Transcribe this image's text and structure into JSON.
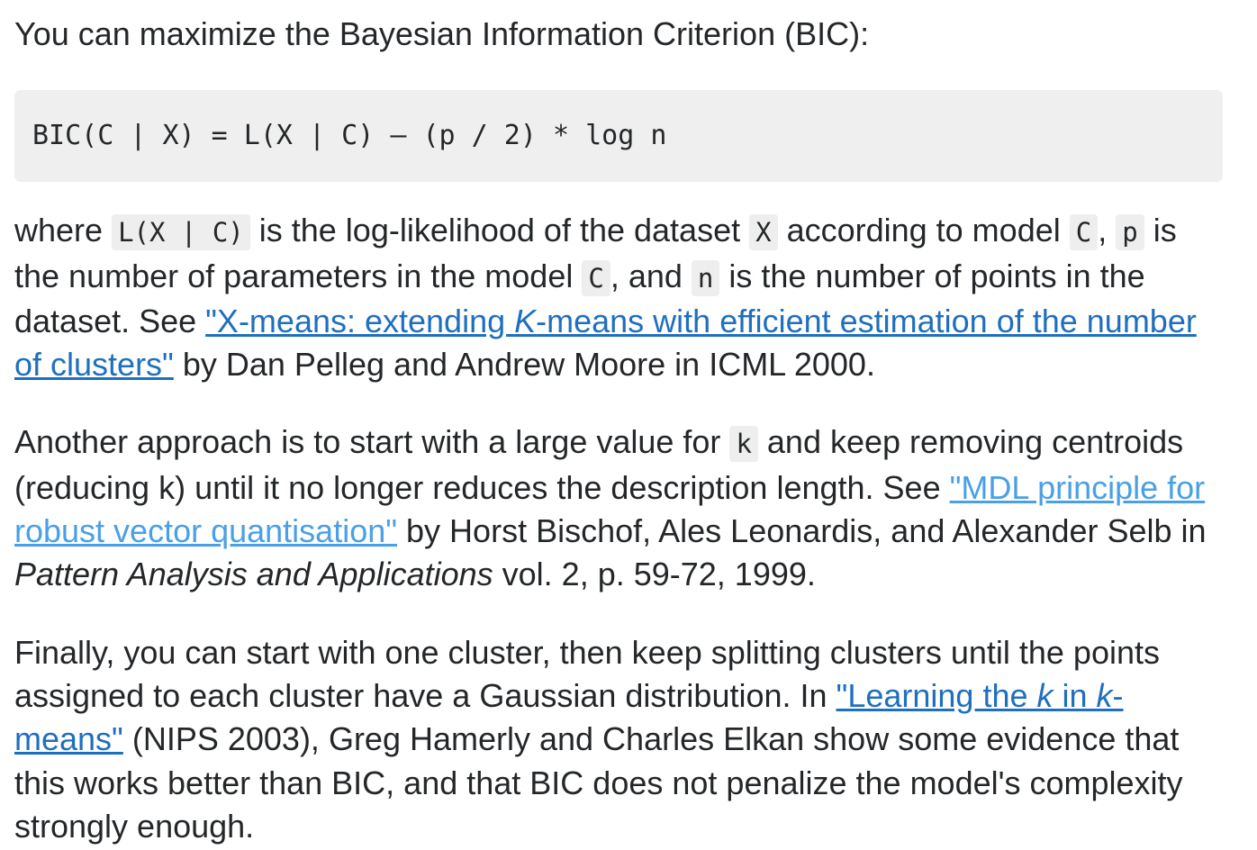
{
  "intro": {
    "text": "You can maximize the Bayesian Information Criterion (BIC):"
  },
  "formula": {
    "code": "BIC(C | X) = L(X | C) – (p / 2) * log n"
  },
  "where_paragraph": {
    "t1": "where ",
    "c1": "L(X | C)",
    "t2": " is the log-likelihood of the dataset ",
    "c2": "X",
    "t3": " according to model ",
    "c3": "C",
    "t4": ", ",
    "c4": "p",
    "t5": " is the number of parameters in the model ",
    "c5": "C",
    "t6": ", and ",
    "c6": "n",
    "t7": " is the number of points in the dataset. See ",
    "link_a": "\"X-means: extending ",
    "link_em": "K",
    "link_b": "-means with efficient estimation of the number of clusters\"",
    "t8": " by Dan Pelleg and Andrew Moore in ICML 2000."
  },
  "mdl_paragraph": {
    "t1": "Another approach is to start with a large value for ",
    "c1": "k",
    "t2": " and keep removing centroids (reducing k) until it no longer reduces the description length. See ",
    "link": "\"MDL principle for robust vector quantisation\"",
    "t3": " by Horst Bischof, Ales Leonardis, and Alexander Selb in ",
    "em": "Pattern Analysis and Applications",
    "t4": " vol. 2, p. 59-72, 1999."
  },
  "gmeans_paragraph": {
    "t1": "Finally, you can start with one cluster, then keep splitting clusters until the points assigned to each cluster have a Gaussian distribution. In ",
    "link_a": "\"Learning the ",
    "link_em1": "k",
    "link_b": " in ",
    "link_em2": "k",
    "link_c": "-means\"",
    "t2": " (NIPS 2003), Greg Hamerly and Charles Elkan show some evidence that this works better than BIC, and that BIC does not penalize the model's complexity strongly enough."
  },
  "colors": {
    "text": "#242729",
    "link_visited": "#1f6fbf",
    "link": "#4aa0e6",
    "code_background": "#efefef"
  }
}
